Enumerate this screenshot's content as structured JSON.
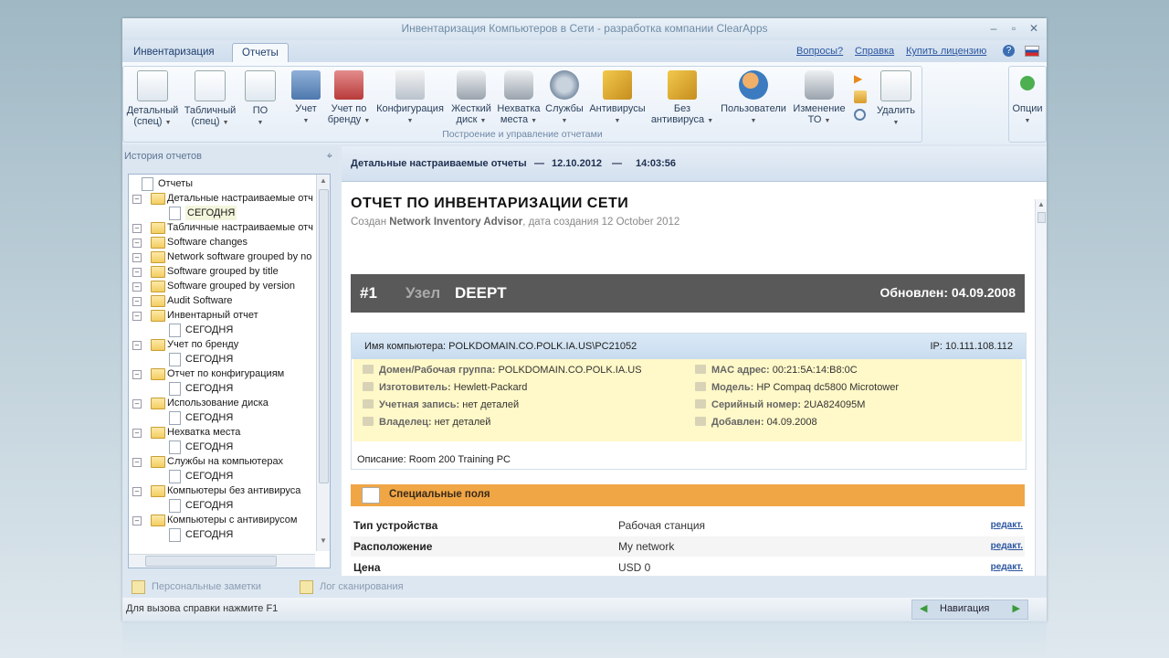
{
  "window": {
    "title": "Инвентаризация Компьютеров в Сети - разработка компании ClearApps"
  },
  "tabs": [
    {
      "label": "Инвентаризация"
    },
    {
      "label": "Отчеты"
    }
  ],
  "top_links": [
    {
      "label": "Вопросы?"
    },
    {
      "label": "Справка"
    },
    {
      "label": "Купить лицензию"
    }
  ],
  "ribbon": {
    "group_label": "Построение и управление отчетами",
    "buttons": [
      {
        "line1": "Детальный",
        "line2": "(спец)",
        "icon": "detailed-report-icon"
      },
      {
        "line1": "Табличный",
        "line2": "(спец)",
        "icon": "table-report-icon"
      },
      {
        "line1": "ПО",
        "line2": "",
        "icon": "software-icon"
      },
      {
        "line1": "Учет",
        "line2": "",
        "icon": "inventory-icon"
      },
      {
        "line1": "Учет по",
        "line2": "бренду",
        "icon": "brand-icon"
      },
      {
        "line1": "Конфигурация",
        "line2": "",
        "icon": "configuration-icon"
      },
      {
        "line1": "Жесткий",
        "line2": "диск",
        "icon": "hard-disk-icon"
      },
      {
        "line1": "Нехватка",
        "line2": "места",
        "icon": "low-space-icon"
      },
      {
        "line1": "Службы",
        "line2": "",
        "icon": "services-gear-icon"
      },
      {
        "line1": "Антивирусы",
        "line2": "",
        "icon": "antivirus-icon"
      },
      {
        "line1": "Без",
        "line2": "антивируса",
        "icon": "no-antivirus-icon"
      },
      {
        "line1": "Пользователи",
        "line2": "",
        "icon": "users-icon"
      },
      {
        "line1": "Изменение",
        "line2": "ТО",
        "icon": "hardware-change-icon"
      },
      {
        "line1": "Удалить",
        "line2": "",
        "icon": "delete-report-icon"
      }
    ],
    "options_label": "Опции"
  },
  "history": {
    "title": "История отчетов",
    "tree": [
      {
        "label": "Отчеты",
        "level": 0,
        "type": "root"
      },
      {
        "label": "Детальные настраиваемые отч",
        "level": 1,
        "type": "folder"
      },
      {
        "label": "СЕГОДНЯ",
        "level": 2,
        "type": "doc",
        "selected": true
      },
      {
        "label": "Табличные настраиваемые отч",
        "level": 1,
        "type": "folder"
      },
      {
        "label": "Software changes",
        "level": 1,
        "type": "folder"
      },
      {
        "label": "Network software grouped by no",
        "level": 1,
        "type": "folder"
      },
      {
        "label": "Software grouped by title",
        "level": 1,
        "type": "folder"
      },
      {
        "label": "Software grouped by version",
        "level": 1,
        "type": "folder"
      },
      {
        "label": "Audit Software",
        "level": 1,
        "type": "folder"
      },
      {
        "label": "Инвентарный отчет",
        "level": 1,
        "type": "folder"
      },
      {
        "label": "СЕГОДНЯ",
        "level": 2,
        "type": "doc"
      },
      {
        "label": "Учет по бренду",
        "level": 1,
        "type": "folder"
      },
      {
        "label": "СЕГОДНЯ",
        "level": 2,
        "type": "doc"
      },
      {
        "label": "Отчет по конфигурациям",
        "level": 1,
        "type": "folder"
      },
      {
        "label": "СЕГОДНЯ",
        "level": 2,
        "type": "doc"
      },
      {
        "label": "Использование диска",
        "level": 1,
        "type": "folder"
      },
      {
        "label": "СЕГОДНЯ",
        "level": 2,
        "type": "doc"
      },
      {
        "label": "Нехватка места",
        "level": 1,
        "type": "folder"
      },
      {
        "label": "СЕГОДНЯ",
        "level": 2,
        "type": "doc"
      },
      {
        "label": "Службы на компьютерах",
        "level": 1,
        "type": "folder"
      },
      {
        "label": "СЕГОДНЯ",
        "level": 2,
        "type": "doc"
      },
      {
        "label": "Компьютеры без антивируса",
        "level": 1,
        "type": "folder"
      },
      {
        "label": "СЕГОДНЯ",
        "level": 2,
        "type": "doc"
      },
      {
        "label": "Компьютеры с антивирусом",
        "level": 1,
        "type": "folder"
      },
      {
        "label": "СЕГОДНЯ",
        "level": 2,
        "type": "doc"
      }
    ]
  },
  "report_header": {
    "name": "Детальные настраиваемые отчеты",
    "sep1": "—",
    "date": "12.10.2012",
    "sep2": "—",
    "time": "14:03:56"
  },
  "report": {
    "title": "ОТЧЕТ ПО ИНВЕНТАРИЗАЦИИ СЕТИ",
    "created_prefix": "Создан",
    "created_by": "Network Inventory Advisor",
    "created_suffix": ", дата создания 12 October 2012",
    "node_num": "#1",
    "node_label": "Узел",
    "node_host": "DEEPT",
    "updated": "Обновлен: 04.09.2008",
    "computer_name": "Имя компьютера: POLKDOMAIN.CO.POLK.IA.US\\PC21052",
    "ip": "IP: 10.111.108.112",
    "details_left": [
      {
        "key": "Домен/Рабочая группа:",
        "value": "POLKDOMAIN.CO.POLK.IA.US"
      },
      {
        "key": "Изготовитель:",
        "value": "Hewlett-Packard"
      },
      {
        "key": "Учетная запись:",
        "value": "нет деталей"
      },
      {
        "key": "Владелец:",
        "value": "нет деталей"
      }
    ],
    "details_right": [
      {
        "key": "MAC адрес:",
        "value": "00:21:5A:14:B8:0C"
      },
      {
        "key": "Модель:",
        "value": "HP Compaq dc5800 Microtower"
      },
      {
        "key": "Серийный номер:",
        "value": "2UA824095M"
      },
      {
        "key": "Добавлен:",
        "value": "04.09.2008"
      }
    ],
    "description": "Описание: Room 200 Training PC",
    "special_fields_title": "Специальные поля",
    "fields": [
      {
        "key": "Тип устройства",
        "value": "Рабочая станция",
        "edit": "редакт."
      },
      {
        "key": "Расположение",
        "value": "My network",
        "edit": "редакт."
      },
      {
        "key": "Цена",
        "value": "USD 0",
        "edit": "редакт."
      }
    ]
  },
  "bottom_tabs": [
    {
      "label": "Персональные заметки"
    },
    {
      "label": "Лог сканирования"
    }
  ],
  "status": {
    "text": "Для вызова справки нажмите F1",
    "nav_label": "Навигация"
  },
  "colors": {
    "accent_orange": "#f0a645",
    "node_bar": "#595959",
    "info_yellow": "#fff8c8",
    "link": "#2c56a0"
  }
}
